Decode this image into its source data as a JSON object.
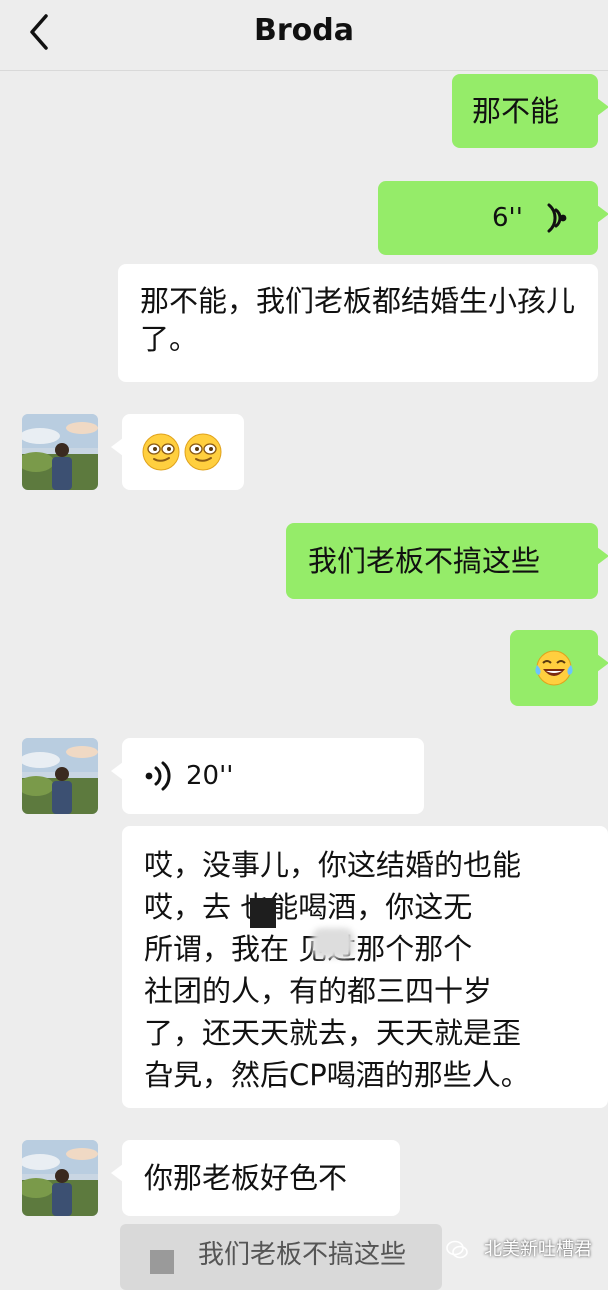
{
  "header": {
    "title": "Broda"
  },
  "messages": {
    "m1": "那不能",
    "m2_duration": "6''",
    "m3": "那不能，我们老板都结婚生小孩儿了。",
    "m5": "我们老板不搞这些",
    "m7_duration": "20''",
    "m8_lines": [
      "哎，没事儿，你这结婚的也能",
      "哎，去 也能喝酒，你这无",
      "所谓，我在 见过那个那个",
      "社团的人，有的都三四十岁",
      "了，还天天就去，天天就是歪",
      "旮旯，然后CP喝酒的那些人。"
    ],
    "m9": "你那老板好色不",
    "quote": "我们老板不搞这些"
  },
  "watermark": "北美新吐槽君",
  "colors": {
    "outgoing": "#95ec69",
    "incoming": "#ffffff",
    "background": "#ededed"
  },
  "icons": [
    "back-arrow-icon",
    "voice-icon",
    "smirk-emoji",
    "laughing-tears-emoji"
  ]
}
